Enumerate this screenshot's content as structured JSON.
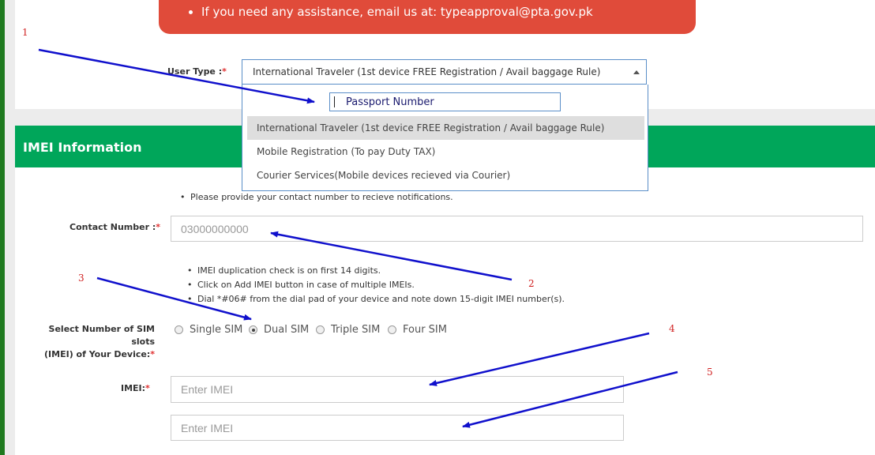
{
  "alert": {
    "bullet": "If you need any assistance, email us at: typeapproval@pta.gov.pk"
  },
  "user_type": {
    "label": "User Type :",
    "required": "*",
    "selected": "International Traveler (1st device FREE Registration / Avail baggage Rule)",
    "search_text": "Passport Number",
    "options": [
      "International Traveler (1st device FREE Registration / Avail baggage Rule)",
      "Mobile Registration (To pay Duty TAX)",
      "Courier Services(Mobile devices recieved via Courier)"
    ]
  },
  "imei_section": {
    "title": "IMEI Information",
    "contact_note": "Please provide your contact number to recieve notifications.",
    "contact_label": "Contact Number :",
    "contact_placeholder": "03000000000",
    "notes": [
      "IMEI duplication check is on first 14 digits.",
      "Click on Add IMEI button in case of multiple IMEIs.",
      "Dial *#06# from the dial pad of your device and note down 15-digit IMEI number(s)."
    ],
    "sim_label_line1": "Select Number of SIM slots",
    "sim_label_line2": "(IMEI) of Your Device:",
    "sim_options": [
      "Single SIM",
      "Dual SIM",
      "Triple SIM",
      "Four SIM"
    ],
    "sim_selected": "Dual SIM",
    "imei_label": "IMEI:",
    "imei_placeholder": "Enter IMEI"
  },
  "annotations": [
    "1",
    "2",
    "3",
    "4",
    "5"
  ],
  "colors": {
    "alert_bg": "#e04b3a",
    "header_green": "#00a65a",
    "arrow_blue": "#1010cc",
    "annotation_red": "#d02020"
  }
}
